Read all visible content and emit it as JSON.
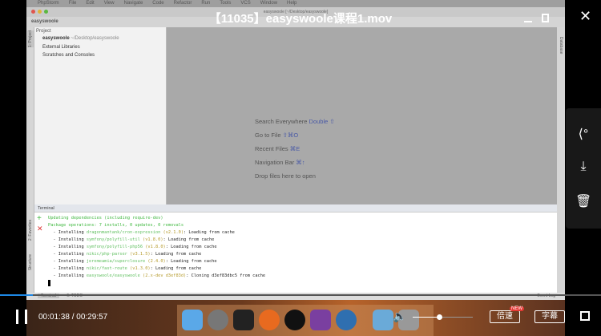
{
  "video_title": "【11035】easyswoole课程1.mov",
  "mac_menu": [
    "PhpStorm",
    "File",
    "Edit",
    "View",
    "Navigate",
    "Code",
    "Refactor",
    "Run",
    "Tools",
    "VCS",
    "Window",
    "Help"
  ],
  "window_title": "easyswoole [~/Desktop/easyswoole]",
  "breadcrumb": "easyswoole",
  "project": {
    "header": "Project",
    "tree": [
      {
        "label": "easyswoole",
        "path": "~/Desktop/easyswoole"
      },
      {
        "label": "External Libraries"
      },
      {
        "label": "Scratches and Consoles"
      }
    ],
    "side_tabs": [
      "1: Project",
      "2: Favorites",
      "Structure"
    ]
  },
  "right_tab": "Database",
  "welcome": [
    {
      "text": "Search Everywhere",
      "key": "Double ⇧"
    },
    {
      "text": "Go to File",
      "key": "⇧⌘O"
    },
    {
      "text": "Recent Files",
      "key": "⌘E"
    },
    {
      "text": "Navigation Bar",
      "key": "⌘↑"
    },
    {
      "text": "Drop files here to open",
      "key": ""
    }
  ],
  "terminal": {
    "title": "Terminal",
    "lines": [
      {
        "pre": "",
        "pkg": "Updating dependencies (including require-dev)",
        "ver": "",
        "post": ""
      },
      {
        "pre": "",
        "pkg": "Package operations: 7 installs, 0 updates, 0 removals",
        "ver": "",
        "post": ""
      },
      {
        "pre": "  - Installing ",
        "pkg": "dragonmantank/cron-expression",
        "ver": "(v2.1.0)",
        "post": ": Loading from cache"
      },
      {
        "pre": "  - Installing ",
        "pkg": "symfony/polyfill-util",
        "ver": "(v1.8.0)",
        "post": ": Loading from cache"
      },
      {
        "pre": "  - Installing ",
        "pkg": "symfony/polyfill-php56",
        "ver": "(v1.8.0)",
        "post": ": Loading from cache"
      },
      {
        "pre": "  - Installing ",
        "pkg": "nikic/php-parser",
        "ver": "(v3.1.5)",
        "post": ": Loading from cache"
      },
      {
        "pre": "  - Installing ",
        "pkg": "jeremeamia/superclosure",
        "ver": "(2.4.0)",
        "post": ": Loading from cache"
      },
      {
        "pre": "  - Installing ",
        "pkg": "nikic/fast-route",
        "ver": "(v1.3.0)",
        "post": ": Loading from cache"
      },
      {
        "pre": "  - Installing ",
        "pkg": "easyswoole/easyswoole",
        "ver": "(2.x-dev d3ef83d)",
        "post": ": Cloning d3ef83dbc5 from cache"
      }
    ]
  },
  "bottom_tabs": {
    "terminal": "Terminal",
    "todo": "6: TODO",
    "event_log": "Event Log"
  },
  "player": {
    "time": "00:01:38 / 00:29:57",
    "progress_percent": 5.5,
    "volume_percent": 45,
    "speed_label": "倍速",
    "speed_badge": "NEW",
    "subtitle_label": "字幕"
  },
  "colors": {
    "progress": "#1e88e5",
    "badge": "#e53935"
  }
}
